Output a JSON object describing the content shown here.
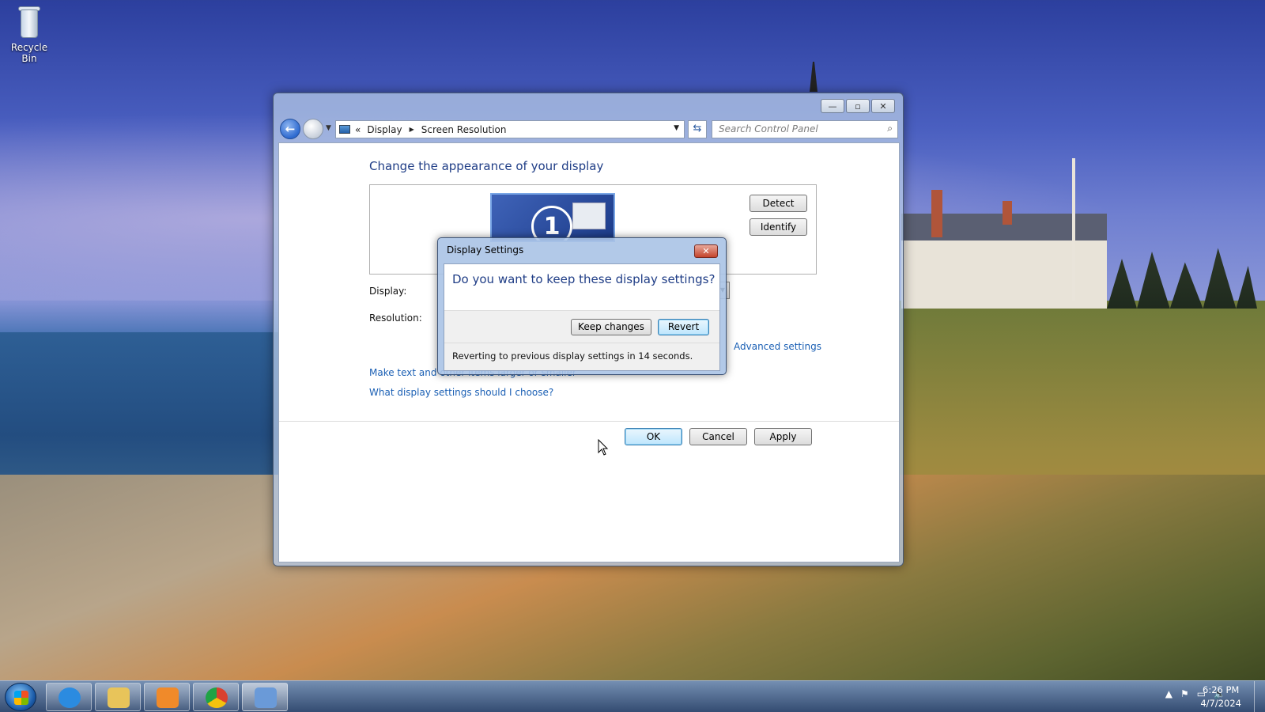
{
  "desktop": {
    "icons": [
      {
        "label": "Recycle Bin",
        "icon": "recycle-bin-icon"
      }
    ]
  },
  "window": {
    "title": "",
    "controls": {
      "minimize": "—",
      "maximize": "▫",
      "close": "✕"
    },
    "address": {
      "crumb_prefix": "«",
      "crumbs": [
        "Display",
        "Screen Resolution"
      ]
    },
    "search": {
      "placeholder": "Search Control Panel"
    },
    "content": {
      "heading": "Change the appearance of your display",
      "monitor_number": "1",
      "detect_label": "Detect",
      "identify_label": "Identify",
      "display_label": "Display:",
      "resolution_label": "Resolution:",
      "advanced_link": "Advanced settings",
      "link_text_size": "Make text and other items larger or smaller",
      "link_choose": "What display settings should I choose?",
      "ok_label": "OK",
      "cancel_label": "Cancel",
      "apply_label": "Apply"
    }
  },
  "dialog": {
    "title": "Display Settings",
    "question": "Do you want to keep these display settings?",
    "keep_label": "Keep changes",
    "revert_label": "Revert",
    "countdown_text": "Reverting to previous display settings in 14 seconds.",
    "close_glyph": "✕"
  },
  "taskbar": {
    "pinned": [
      {
        "name": "internet-explorer",
        "color": "#2b8be0"
      },
      {
        "name": "file-explorer",
        "color": "#e8c45a"
      },
      {
        "name": "media-player",
        "color": "#f08a2a"
      },
      {
        "name": "chrome",
        "color": "#d9412f"
      },
      {
        "name": "control-panel",
        "color": "#6a9ad8"
      }
    ],
    "tray_icons": [
      "▲",
      "⚑",
      "▭",
      "🔈"
    ],
    "time": "6:26 PM",
    "date": "4/7/2024"
  },
  "colors": {
    "heading": "#1f3d86",
    "link": "#1a5fb4",
    "default_button": "#3c7fb1"
  }
}
